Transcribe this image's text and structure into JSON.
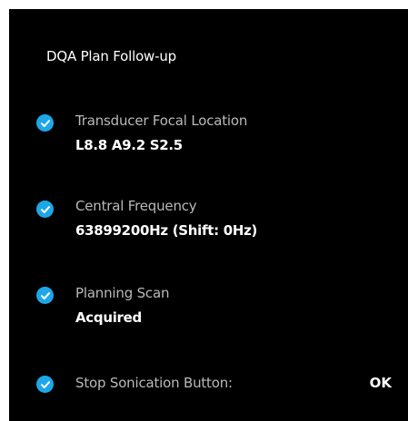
{
  "panel": {
    "title": "DQA Plan Follow-up",
    "items": [
      {
        "icon": "checkmark-icon",
        "label": "Transducer Focal Location",
        "value": "L8.8 A9.2 S2.5"
      },
      {
        "icon": "checkmark-icon",
        "label": "Central Frequency",
        "value": "63899200Hz (Shift: 0Hz)"
      },
      {
        "icon": "checkmark-icon",
        "label": "Planning Scan",
        "value": "Acquired"
      },
      {
        "icon": "checkmark-icon",
        "label": "Stop Sonication Button:",
        "value": "OK"
      }
    ]
  },
  "colors": {
    "background": "#000000",
    "accent": "#1ea7e8",
    "label": "#b9b9b9",
    "value": "#ffffff"
  }
}
